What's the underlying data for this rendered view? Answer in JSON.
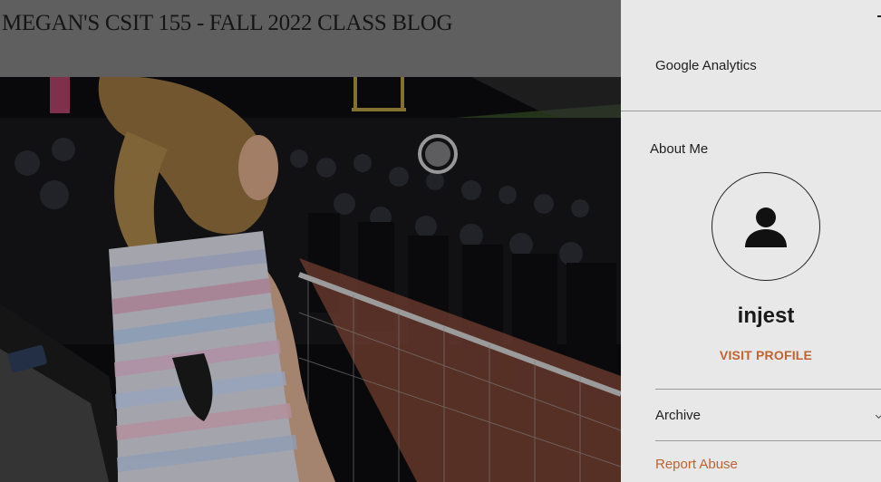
{
  "header": {
    "blog_title": "MEGAN'S CSIT 155 - FALL 2022 CLASS BLOG"
  },
  "hero": {
    "description": ""
  },
  "sidebar": {
    "google_analytics": "Google Analytics",
    "about_me": "About Me",
    "username": "injest",
    "visit_profile": "VISIT PROFILE",
    "archive": "Archive",
    "report_abuse": "Report Abuse"
  },
  "icons": {
    "avatar": "person-icon",
    "archive_toggle": "chevron-down-icon"
  },
  "colors": {
    "accent": "#c1622f",
    "sidebar_bg": "#e8e8e8",
    "header_bg": "#5f5f5f"
  }
}
